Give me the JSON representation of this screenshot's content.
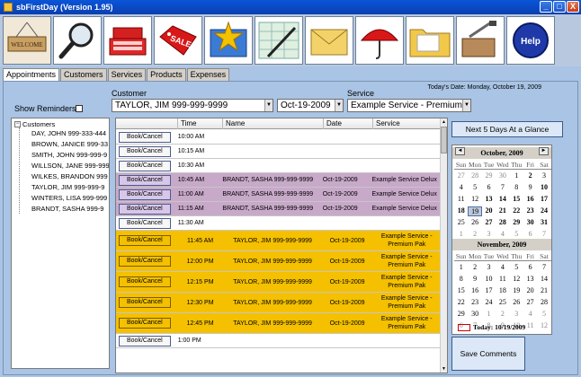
{
  "window": {
    "title": "sbFirstDay  (Version 1.95)",
    "minimize": "_",
    "maximize": "□",
    "close": "X"
  },
  "toolbar": [
    {
      "icon": "welcome-sign-icon",
      "label": "WELCOME"
    },
    {
      "icon": "magnifier-icon",
      "label": ""
    },
    {
      "icon": "cash-register-icon",
      "label": ""
    },
    {
      "icon": "sale-tag-icon",
      "label": "SALE"
    },
    {
      "icon": "star-box-icon",
      "label": ""
    },
    {
      "icon": "spreadsheet-pen-icon",
      "label": ""
    },
    {
      "icon": "envelope-icon",
      "label": ""
    },
    {
      "icon": "umbrella-icon",
      "label": ""
    },
    {
      "icon": "folder-icon",
      "label": ""
    },
    {
      "icon": "toolbox-icon",
      "label": ""
    },
    {
      "icon": "help-icon",
      "label": "Help"
    }
  ],
  "tabs": [
    "Appointments",
    "Customers",
    "Services",
    "Products",
    "Expenses"
  ],
  "todays_date": "Today's Date: Monday, October 19, 2009",
  "show_reminders": "Show Reminders",
  "customer_label": "Customer",
  "customer_value": "TAYLOR, JIM 999-999-9999",
  "date_value": "Oct-19-2009",
  "service_label": "Service",
  "service_value": "Example Service - Premium P",
  "tree": {
    "root": "Customers",
    "items": [
      "DAY, JOHN 999-333-444",
      "BROWN, JANICE 999-33",
      "SMITH, JOHN 999-999-9",
      "WILLSON, JANE 999-999",
      "WILKES, BRANDON 999",
      "TAYLOR, JIM 999-999-9",
      "WINTERS, LISA 999-999",
      "BRANDT, SASHA 999-9"
    ]
  },
  "grid": {
    "columns": [
      "",
      "Time",
      "Name",
      "Date",
      "Service"
    ],
    "rows": [
      {
        "btn": "Book/Cancel",
        "time": "10:00 AM",
        "name": "",
        "date": "",
        "service": "",
        "style": "white"
      },
      {
        "btn": "Book/Cancel",
        "time": "10:15 AM",
        "name": "",
        "date": "",
        "service": "",
        "style": "white"
      },
      {
        "btn": "Book/Cancel",
        "time": "10:30 AM",
        "name": "",
        "date": "",
        "service": "",
        "style": "white"
      },
      {
        "btn": "Book/Cancel",
        "time": "10:45 AM",
        "name": "BRANDT, SASHA 999-999-9999",
        "date": "Oct-19-2009",
        "service": "Example Service Delux",
        "style": "purple"
      },
      {
        "btn": "Book/Cancel",
        "time": "11:00 AM",
        "name": "BRANDT, SASHA 999-999-9999",
        "date": "Oct-19-2009",
        "service": "Example Service Delux",
        "style": "purple"
      },
      {
        "btn": "Book/Cancel",
        "time": "11:15 AM",
        "name": "BRANDT, SASHA 999-999-9999",
        "date": "Oct-19-2009",
        "service": "Example Service Delux",
        "style": "purple"
      },
      {
        "btn": "Book/Cancel",
        "time": "11:30 AM",
        "name": "",
        "date": "",
        "service": "",
        "style": "white"
      },
      {
        "btn": "Book/Cancel",
        "time": "11:45 AM",
        "name": "TAYLOR, JIM 999-999-9999",
        "date": "Oct-19-2009",
        "service": "Example Service - Premium Pak",
        "style": "yellow"
      },
      {
        "btn": "Book/Cancel",
        "time": "12:00 PM",
        "name": "TAYLOR, JIM 999-999-9999",
        "date": "Oct-19-2009",
        "service": "Example Service - Premium Pak",
        "style": "yellow"
      },
      {
        "btn": "Book/Cancel",
        "time": "12:15 PM",
        "name": "TAYLOR, JIM 999-999-9999",
        "date": "Oct-19-2009",
        "service": "Example Service - Premium Pak",
        "style": "yellow"
      },
      {
        "btn": "Book/Cancel",
        "time": "12:30 PM",
        "name": "TAYLOR, JIM 999-999-9999",
        "date": "Oct-19-2009",
        "service": "Example Service - Premium Pak",
        "style": "yellow"
      },
      {
        "btn": "Book/Cancel",
        "time": "12:45 PM",
        "name": "TAYLOR, JIM 999-999-9999",
        "date": "Oct-19-2009",
        "service": "Example Service - Premium Pak",
        "style": "yellow"
      },
      {
        "btn": "Book/Cancel",
        "time": "1:00 PM",
        "name": "",
        "date": "",
        "service": "",
        "style": "white"
      }
    ]
  },
  "next5": "Next 5 Days At a Glance",
  "save_comments": "Save Comments",
  "calendar": {
    "dow": [
      "Sun",
      "Mon",
      "Tue",
      "Wed",
      "Thu",
      "Fri",
      "Sat"
    ],
    "month1": {
      "title": "October, 2009",
      "weeks": [
        [
          "27",
          "28",
          "29",
          "30",
          "1",
          "2",
          "3"
        ],
        [
          "4",
          "5",
          "6",
          "7",
          "8",
          "9",
          "10"
        ],
        [
          "11",
          "12",
          "13",
          "14",
          "15",
          "16",
          "17"
        ],
        [
          "18",
          "19",
          "20",
          "21",
          "22",
          "23",
          "24"
        ],
        [
          "25",
          "26",
          "27",
          "28",
          "29",
          "30",
          "31"
        ],
        [
          "1",
          "2",
          "3",
          "4",
          "5",
          "6",
          "7"
        ]
      ]
    },
    "month2": {
      "title": "November, 2009",
      "weeks": [
        [
          "1",
          "2",
          "3",
          "4",
          "5",
          "6",
          "7"
        ],
        [
          "8",
          "9",
          "10",
          "11",
          "12",
          "13",
          "14"
        ],
        [
          "15",
          "16",
          "17",
          "18",
          "19",
          "20",
          "21"
        ],
        [
          "22",
          "23",
          "24",
          "25",
          "26",
          "27",
          "28"
        ],
        [
          "29",
          "30",
          "1",
          "2",
          "3",
          "4",
          "5"
        ],
        [
          "6",
          "7",
          "8",
          "9",
          "10",
          "11",
          "12"
        ]
      ]
    },
    "today": "Today: 10/19/2009",
    "prev": "◄",
    "next": "►"
  }
}
